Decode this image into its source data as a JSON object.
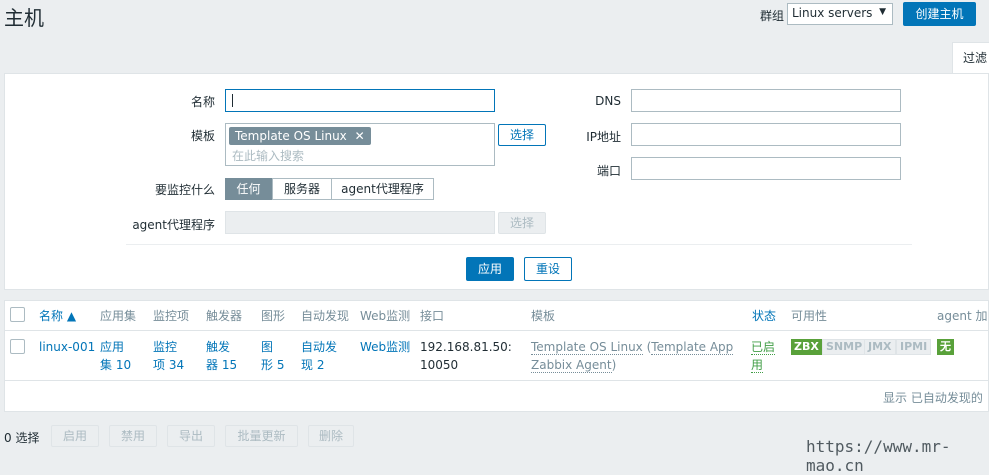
{
  "header": {
    "title": "主机",
    "group_label": "群组",
    "group_value": "Linux servers",
    "create_button": "创建主机",
    "filter_tab": "过滤"
  },
  "filter": {
    "name_label": "名称",
    "name_value": "",
    "template_label": "模板",
    "template_tag": "Template OS Linux",
    "template_placeholder": "在此输入搜索",
    "select_button": "选择",
    "monitored_by_label": "要监控什么",
    "monitored_options": [
      "任何",
      "服务器",
      "agent代理程序"
    ],
    "monitored_selected": "任何",
    "proxy_label": "agent代理程序",
    "proxy_select_button": "选择",
    "dns_label": "DNS",
    "ip_label": "IP地址",
    "port_label": "端口",
    "apply_button": "应用",
    "reset_button": "重设"
  },
  "table": {
    "columns": [
      "名称 ▲",
      "应用集",
      "监控项",
      "触发器",
      "图形",
      "自动发现",
      "Web监测",
      "接口",
      "模板",
      "状态",
      "可用性",
      "agent 加密"
    ],
    "rows": [
      {
        "name": "linux-001",
        "apps_1": "应用",
        "apps_2": "集 10",
        "items_1": "监控",
        "items_2": "项 34",
        "triggers_1": "触发",
        "triggers_2": "器 15",
        "graphs_1": "图",
        "graphs_2": "形 5",
        "discovery_1": "自动发",
        "discovery_2": "现 2",
        "web": "Web监测",
        "interface_1": "192.168.81.50:",
        "interface_2": "10050",
        "template_main": "Template OS Linux",
        "template_paren_open": " (",
        "template_sub_1": "Template App",
        "template_sub_2": "Zabbix Agent",
        "template_paren_close": ")",
        "status_1": "已启",
        "status_2": "用",
        "availability": [
          "ZBX",
          "SNMP",
          "JMX",
          "IPMI"
        ],
        "encryption": "无"
      }
    ],
    "footer": "显示 已自动发现的"
  },
  "mass_actions": {
    "selected": "0 选择",
    "buttons": [
      "启用",
      "禁用",
      "导出",
      "批量更新",
      "删除"
    ]
  },
  "watermark": "https://www.mr-mao.cn",
  "colors": {
    "accent": "#0275b8",
    "ok_green": "#59a13a",
    "status_green": "#429e47",
    "background": "#ebeef0"
  }
}
